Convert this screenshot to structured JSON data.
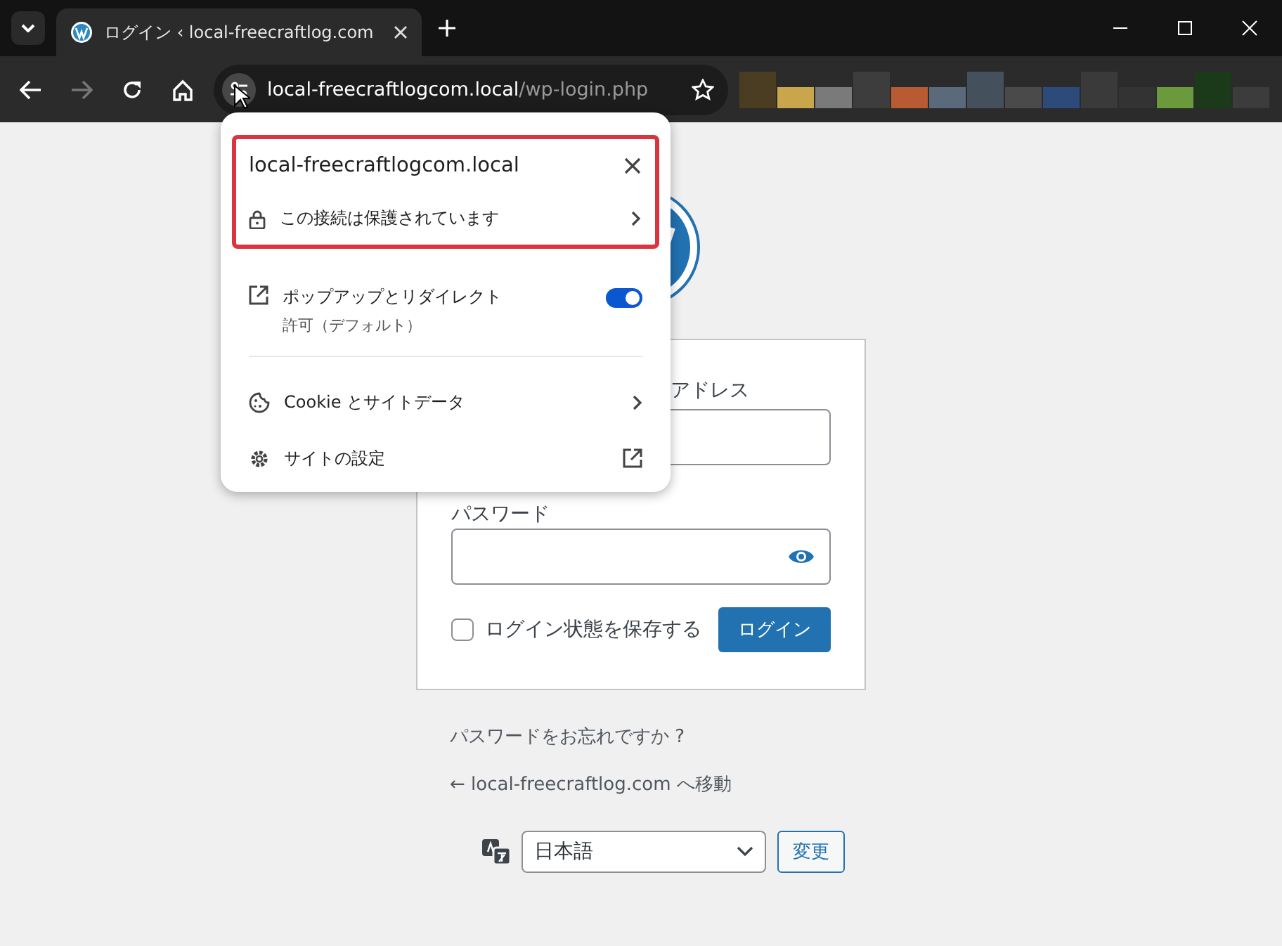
{
  "browser": {
    "tab": {
      "title": "ログイン ‹ local-freecraftlog.com"
    },
    "address": {
      "host": "local-freecraftlogcom.local",
      "path": "/wp-login.php"
    }
  },
  "site_info": {
    "host": "local-freecraftlogcom.local",
    "connection": "この接続は保護されています",
    "permissions": [
      {
        "label": "ポップアップとリダイレクト",
        "detail": "許可（デフォルト）",
        "on": true
      }
    ],
    "items": [
      {
        "label": "Cookie とサイトデータ",
        "kind": "submenu"
      },
      {
        "label": "サイトの設定",
        "kind": "external"
      }
    ]
  },
  "login": {
    "username_label": "アドレス",
    "password_label": "パスワード",
    "remember": {
      "label": "ログイン状態を保存する",
      "checked": false
    },
    "submit": "ログイン",
    "lost_password": "パスワードをお忘れですか ?",
    "back": "← local-freecraftlog.com へ移動",
    "language": {
      "value": "日本語",
      "button": "変更"
    }
  }
}
